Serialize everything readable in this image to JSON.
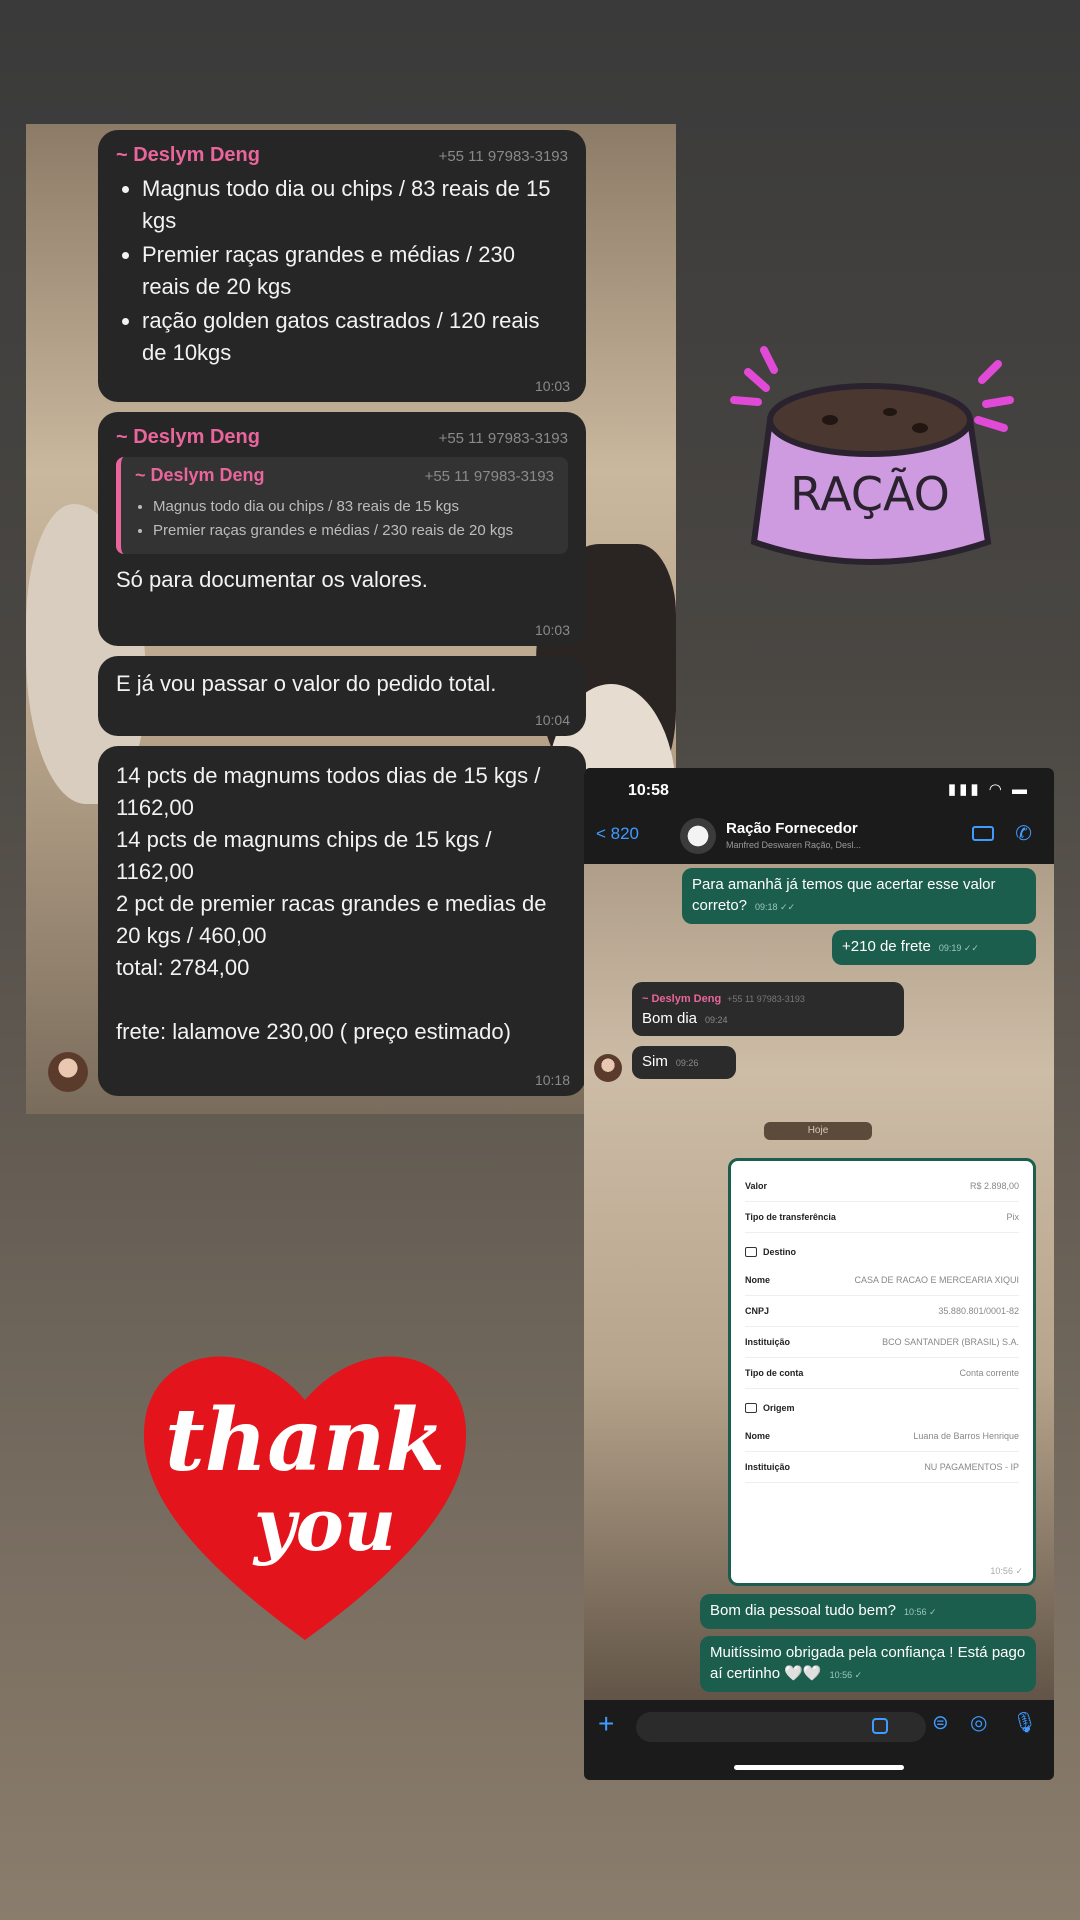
{
  "left_chat": {
    "msg1": {
      "sender": "~ Deslym Deng",
      "phone": "+55 11 97983-3193",
      "items": [
        "Magnus todo dia ou chips  / 83 reais de 15 kgs",
        "Premier raças grandes e médias  / 230 reais de 20 kgs",
        "ração golden gatos castrados / 120 reais de 10kgs"
      ],
      "time": "10:03"
    },
    "msg2": {
      "sender": "~ Deslym Deng",
      "phone": "+55 11 97983-3193",
      "quote_sender": "~ Deslym Deng",
      "quote_phone": "+55 11 97983-3193",
      "quote_items": [
        "Magnus todo dia ou chips  / 83 reais de 15 kgs",
        "Premier raças grandes e médias  / 230 reais de 20 kgs"
      ],
      "text": "Só para documentar os valores.",
      "time": "10:03"
    },
    "msg3": {
      "text": "E já vou passar o valor do pedido total.",
      "time": "10:04"
    },
    "msg4": {
      "text": "14 pcts de magnums todos dias de 15 kgs / 1162,00\n14 pcts de magnums chips de 15 kgs / 1162,00\n2 pct de premier racas grandes e medias de 20 kgs / 460,00\ntotal: 2784,00\n\nfrete: lalamove 230,00 ( preço estimado)",
      "time": "10:18"
    }
  },
  "phone": {
    "clock": "10:58",
    "status_icons": "▮▮▮ ◠ ▬",
    "back": "< 820",
    "group_name": "Ração Fornecedor",
    "group_sub": "Manfred Deswaren Ração, Desl...",
    "messages": {
      "out1": {
        "text": "Para amanhã já temos que acertar esse valor correto?",
        "time": "09:18 ✓✓"
      },
      "out2": {
        "text": "+210 de frete",
        "time": "09:19 ✓✓"
      },
      "in1": {
        "sender": "~ Deslym Deng",
        "phone": "+55 11 97983-3193",
        "text": "Bom dia",
        "time": "09:24"
      },
      "in2": {
        "text": "Sim",
        "time": "09:26"
      },
      "day_pill": "Hoje",
      "out3": {
        "text": "Bom dia pessoal tudo bem?",
        "time": "10:56 ✓"
      },
      "out4": {
        "text": "Muitíssimo obrigada pela confiança ! Está pago aí certinho 🤍🤍",
        "time": "10:56 ✓"
      }
    },
    "receipt": {
      "rows_top": [
        {
          "label": "Valor",
          "value": "R$ 2.898,00"
        },
        {
          "label": "Tipo de transferência",
          "value": "Pix"
        }
      ],
      "destino_title": "Destino",
      "destino_rows": [
        {
          "label": "Nome",
          "value": "CASA DE RACAO E MERCEARIA XIQUI"
        },
        {
          "label": "CNPJ",
          "value": "35.880.801/0001-82"
        },
        {
          "label": "Instituição",
          "value": "BCO SANTANDER (BRASIL) S.A."
        },
        {
          "label": "Tipo de conta",
          "value": "Conta corrente"
        }
      ],
      "origem_title": "Origem",
      "origem_rows": [
        {
          "label": "Nome",
          "value": "Luana de Barros Henrique"
        },
        {
          "label": "Instituição",
          "value": "NU PAGAMENTOS - IP"
        }
      ],
      "time": "10:56 ✓"
    },
    "input_placeholder": ""
  },
  "stickers": {
    "racao_text": "RAÇÃO",
    "thank_text": "thank",
    "you_text": "you"
  },
  "colors": {
    "pink_sender": "#e9659c",
    "outgoing_bubble": "#1c5e4d",
    "ios_blue": "#3f9bff",
    "racao_bowl": "#cf9be0",
    "heart_red": "#e3141b"
  }
}
